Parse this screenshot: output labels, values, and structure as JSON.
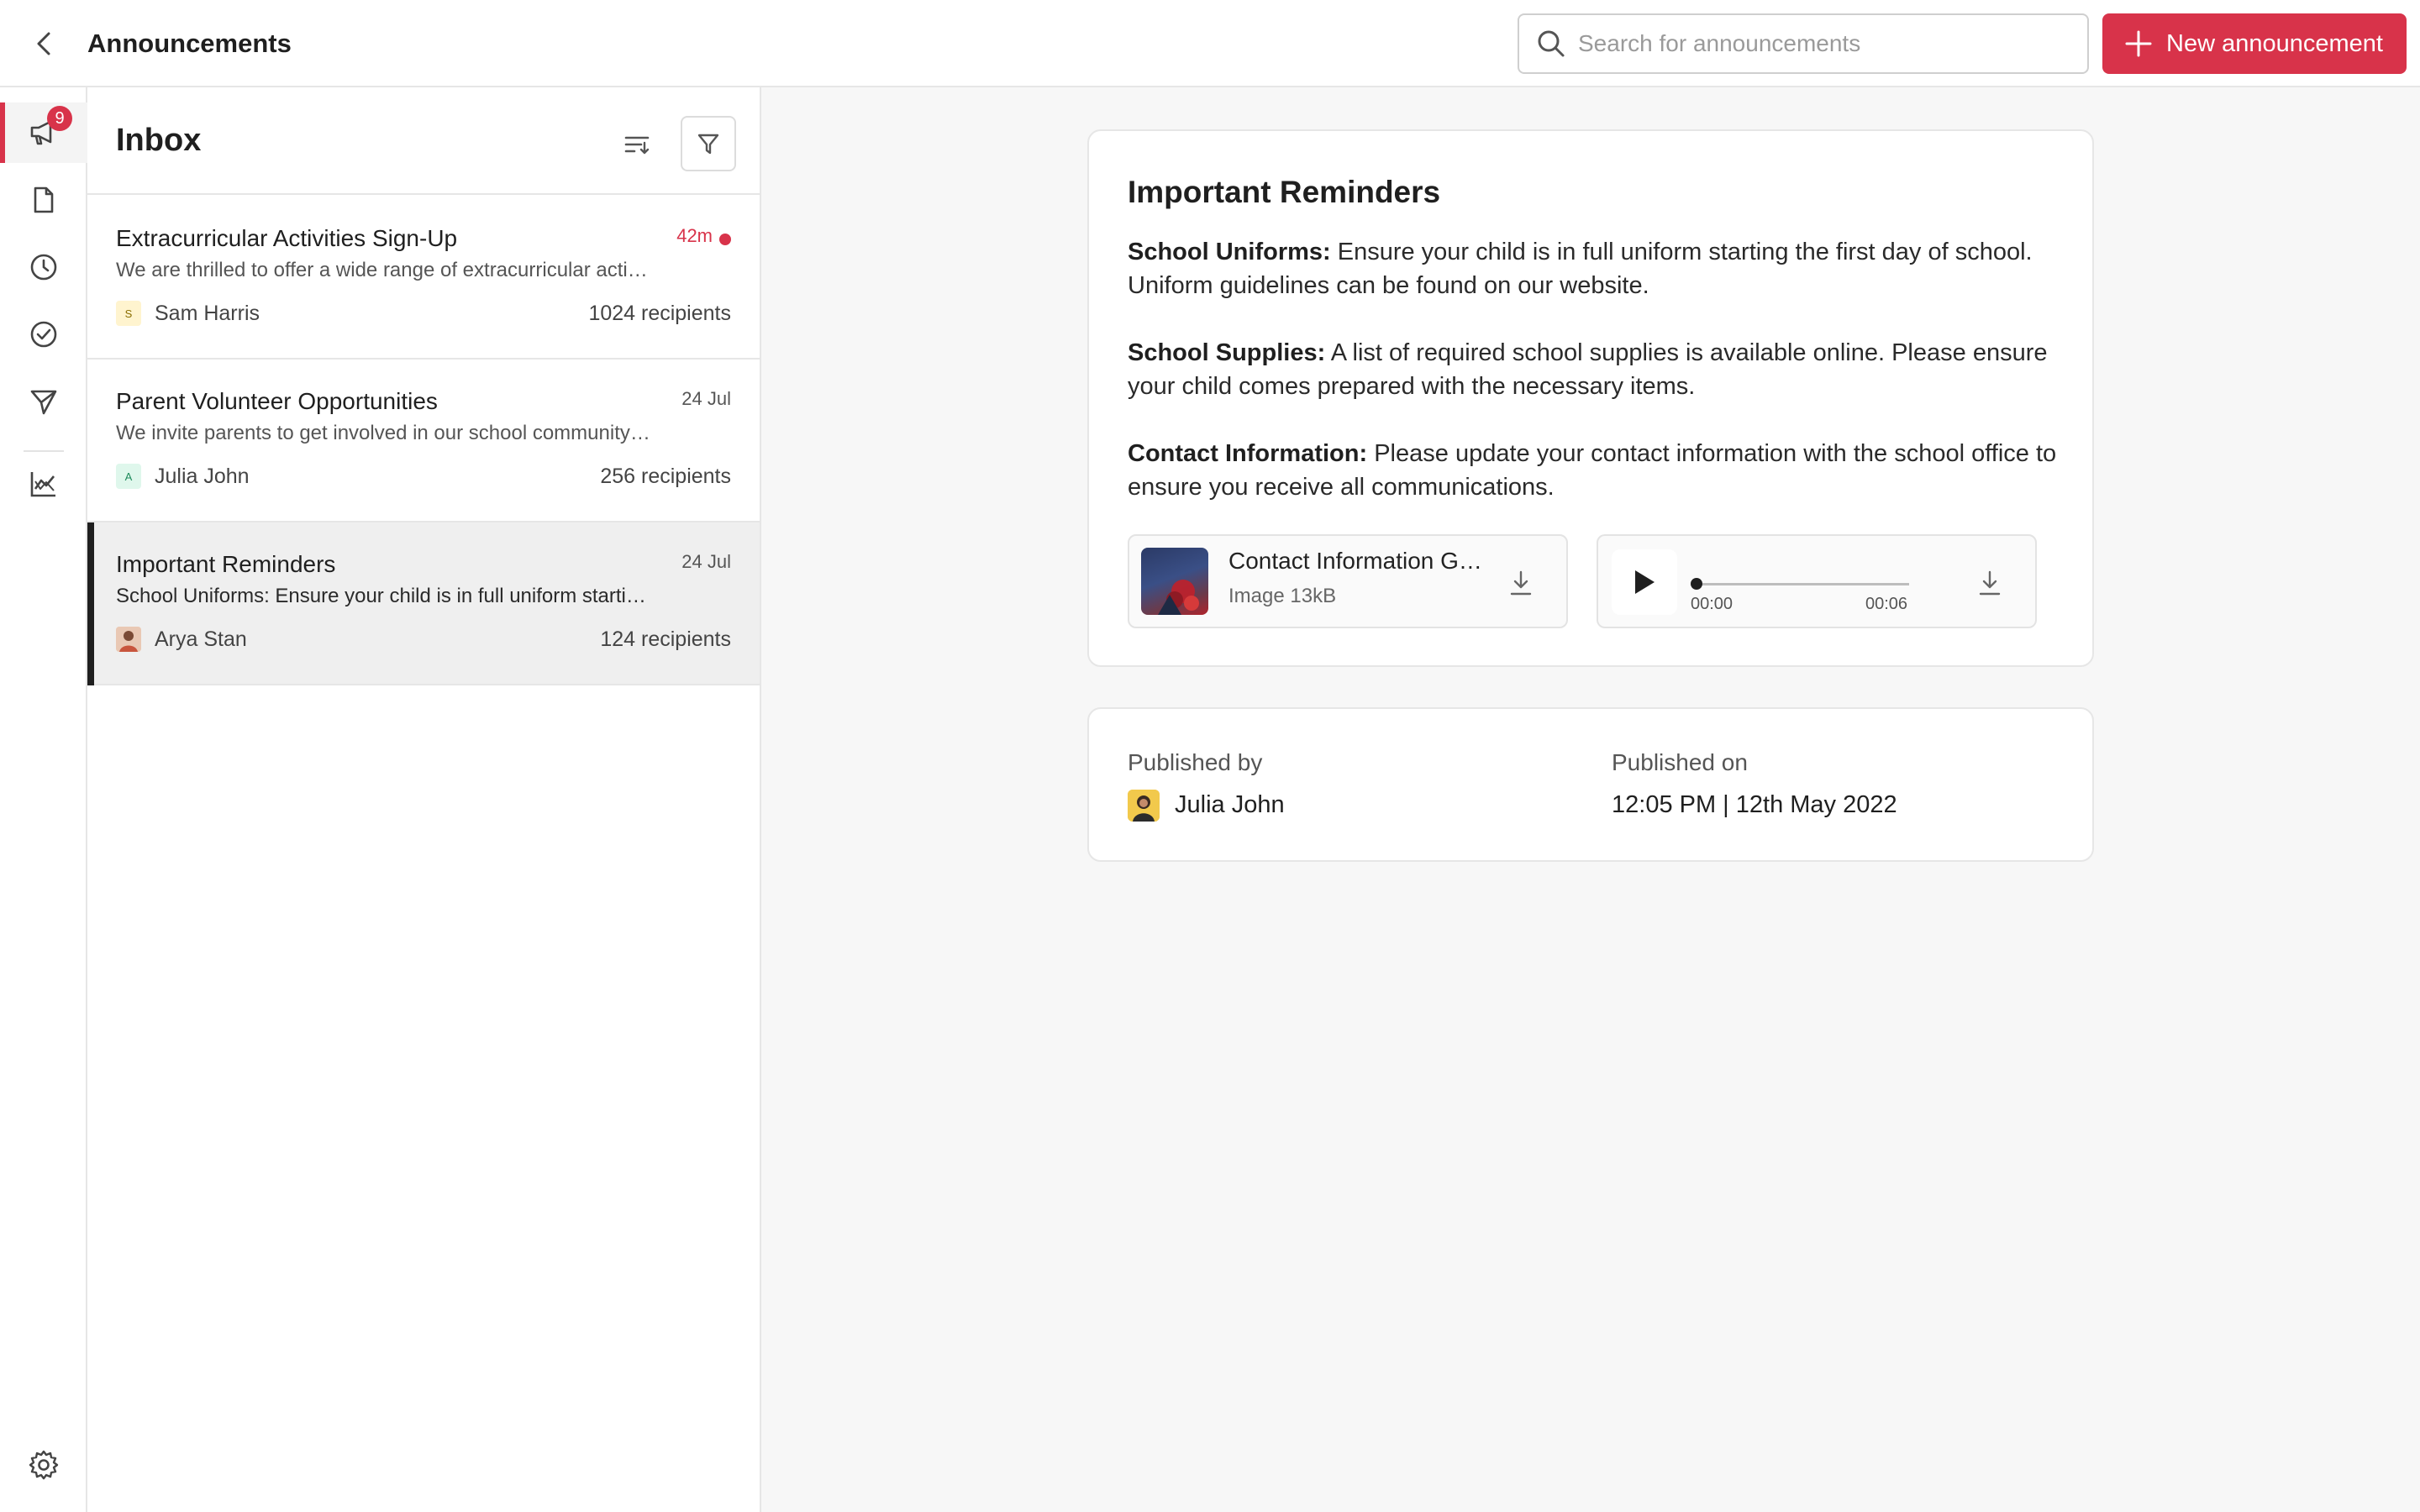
{
  "header": {
    "title": "Announcements",
    "search_placeholder": "Search for announcements",
    "new_button_label": "New announcement"
  },
  "rail": {
    "badge_count": "9",
    "items": [
      "announcements-icon",
      "document-icon",
      "clock-icon",
      "check-circle-icon",
      "send-icon",
      "analytics-icon"
    ],
    "settings_icon": "gear-icon"
  },
  "inbox": {
    "title": "Inbox",
    "messages": [
      {
        "title": "Extracurricular Activities Sign-Up",
        "time": "42m",
        "unread": true,
        "preview": "We are thrilled to offer a wide range of extracurricular activities this year",
        "author_initial": "S",
        "author": "Sam Harris",
        "recipients": "1024 recipients"
      },
      {
        "title": "Parent Volunteer Opportunities",
        "time": "24 Jul",
        "unread": false,
        "preview": "We invite parents to get involved in our school community through volunteering",
        "author_initial": "A",
        "author": "Julia John",
        "recipients": "256 recipients"
      },
      {
        "title": "Important Reminders",
        "time": "24 Jul",
        "unread": false,
        "preview": "School Uniforms: Ensure your child is in full uniform starting the first day of school.",
        "author_initial": "",
        "author": "Arya Stan",
        "recipients": "124 recipients"
      }
    ]
  },
  "detail": {
    "title": "Important Reminders",
    "sections": [
      {
        "heading": "School Uniforms:",
        "text": " Ensure your child is in full uniform starting the first day of school. Uniform guidelines can be found on our website."
      },
      {
        "heading": "School Supplies:",
        "text": " A list of required school supplies is available online. Please ensure your child comes prepared with the necessary items."
      },
      {
        "heading": "Contact Information:",
        "text": " Please update your contact information with the school office to ensure you receive all communications."
      }
    ],
    "attachments": {
      "image": {
        "name": "Contact Information Guidelines",
        "meta": "Image 13kB"
      },
      "audio": {
        "current": "00:00",
        "total": "00:06",
        "progress": 0
      }
    },
    "published": {
      "by_label": "Published by",
      "by_name": "Julia John",
      "on_label": "Published on",
      "on_value": "12:05 PM | 12th May 2022"
    }
  },
  "colors": {
    "accent": "#d8334a",
    "text": "#1f1f1f",
    "panel_bg": "#f7f7f7",
    "border": "#e6e6e6"
  }
}
